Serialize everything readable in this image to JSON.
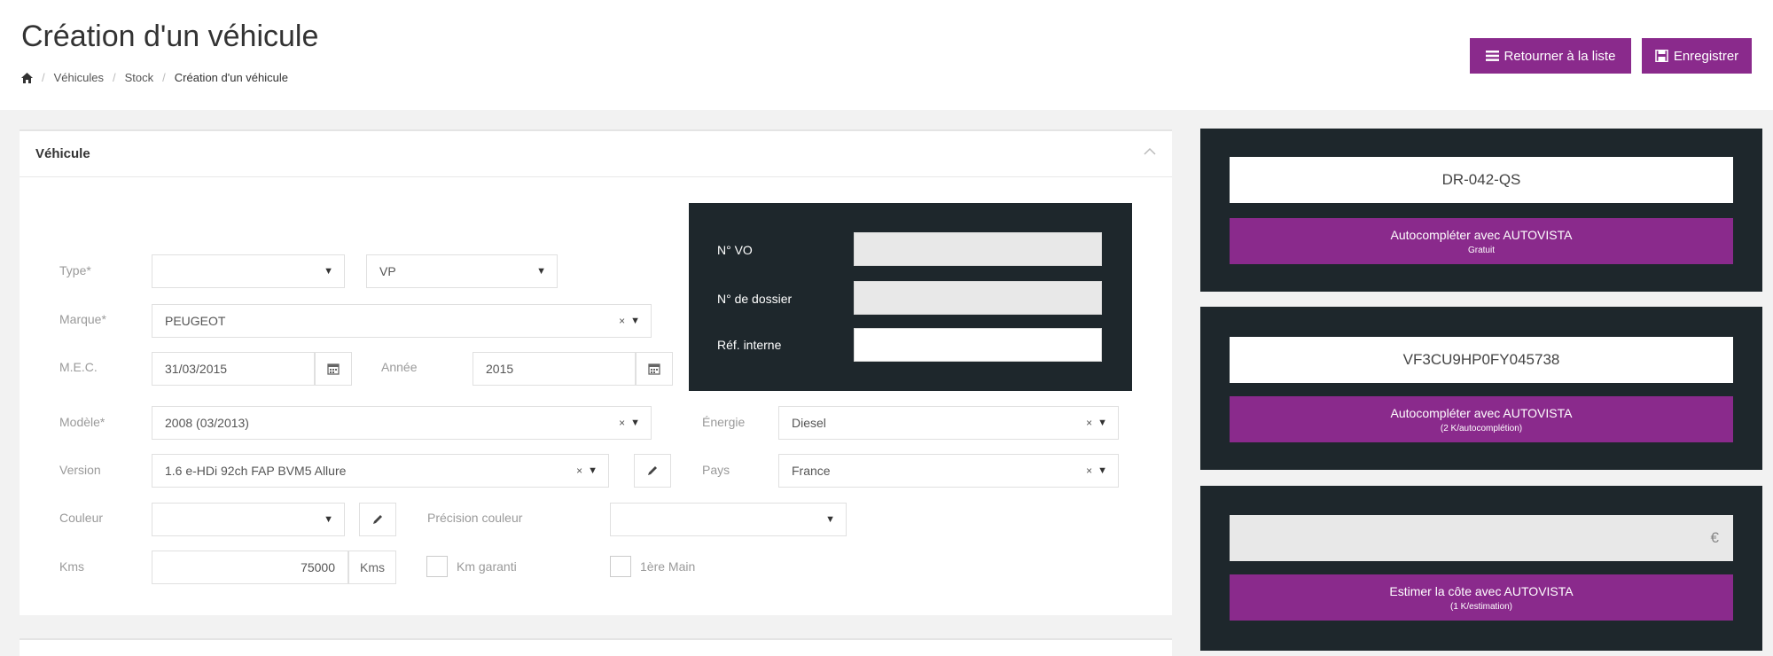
{
  "header": {
    "title": "Création d'un véhicule",
    "breadcrumb": [
      "Véhicules",
      "Stock",
      "Création d'un véhicule"
    ],
    "btn_list": "Retourner à la liste",
    "btn_save": "Enregistrer"
  },
  "panel": {
    "title": "Véhicule"
  },
  "form": {
    "type_label": "Type*",
    "type_value": "",
    "type2_value": "VP",
    "marque_label": "Marque*",
    "marque_value": "PEUGEOT",
    "mec_label": "M.E.C.",
    "mec_value": "31/03/2015",
    "annee_label": "Année",
    "annee_value": "2015",
    "modele_label": "Modèle*",
    "modele_value": "2008 (03/2013)",
    "energie_label": "Énergie",
    "energie_value": "Diesel",
    "version_label": "Version",
    "version_value": "1.6 e-HDi 92ch FAP BVM5 Allure",
    "pays_label": "Pays",
    "pays_value": "France",
    "couleur_label": "Couleur",
    "couleur_value": "",
    "precision_label": "Précision couleur",
    "precision_value": "",
    "kms_label": "Kms",
    "kms_value": "75000",
    "kms_unit": "Kms",
    "km_garanti_label": "Km garanti",
    "premiere_main_label": "1ère Main",
    "clear_symbol": "×",
    "caret_symbol": "▼"
  },
  "dossier": {
    "vo_label": "N° VO",
    "dossier_label": "N° de dossier",
    "ref_label": "Réf. interne"
  },
  "autovista": {
    "plate": "DR-042-QS",
    "plate_btn": "Autocompléter avec AUTOVISTA",
    "plate_btn_sub": "Gratuit",
    "vin": "VF3CU9HP0FY045738",
    "vin_btn": "Autocompléter avec AUTOVISTA",
    "vin_btn_sub": "(2 K/autocomplétion)",
    "estimate_currency": "€",
    "estimate_btn": "Estimer la côte avec AUTOVISTA",
    "estimate_btn_sub": "(1 K/estimation)"
  },
  "colors": {
    "accent": "#8a2a8c",
    "dark": "#1e272c"
  }
}
